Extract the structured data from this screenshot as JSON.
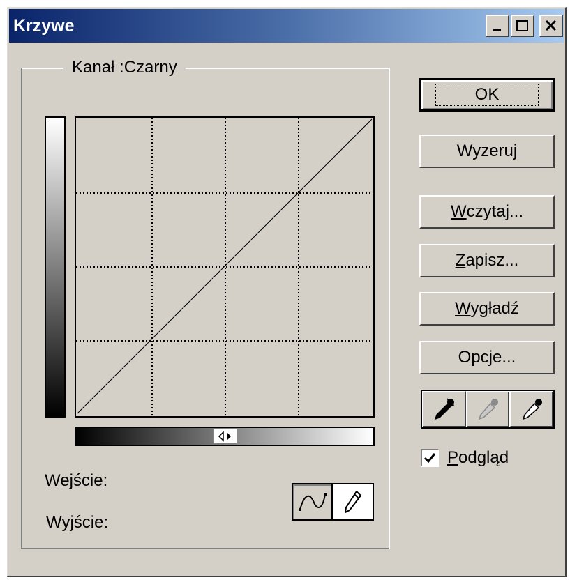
{
  "window": {
    "title": "Krzywe"
  },
  "channel": {
    "legend": "Kanał :Czarny"
  },
  "buttons": {
    "ok": "OK",
    "reset": "Wyzeruj",
    "load_underline": "W",
    "load_rest": "czytaj...",
    "save_underline": "Z",
    "save_rest": "apisz...",
    "smooth_underline": "W",
    "smooth_rest": "ygładź",
    "options": "Opcje..."
  },
  "preview": {
    "underline": "P",
    "rest": "odgląd",
    "checked": true
  },
  "readouts": {
    "input_label": "Wejście:",
    "output_label": "Wyjście:"
  },
  "icons": {
    "minimize": "minimize-icon",
    "maximize": "maximize-icon",
    "close": "close-icon",
    "curve_tool": "curve-tool-icon",
    "pencil_tool": "pencil-icon",
    "black_eyedropper": "eyedropper-black-icon",
    "gray_eyedropper": "eyedropper-gray-icon",
    "white_eyedropper": "eyedropper-white-icon",
    "gradient_toggle": "gradient-direction-toggle-icon"
  },
  "colors": {
    "dialog_bg": "#d4d0c8",
    "title_start": "#0a246a",
    "title_end": "#a6caf0"
  }
}
